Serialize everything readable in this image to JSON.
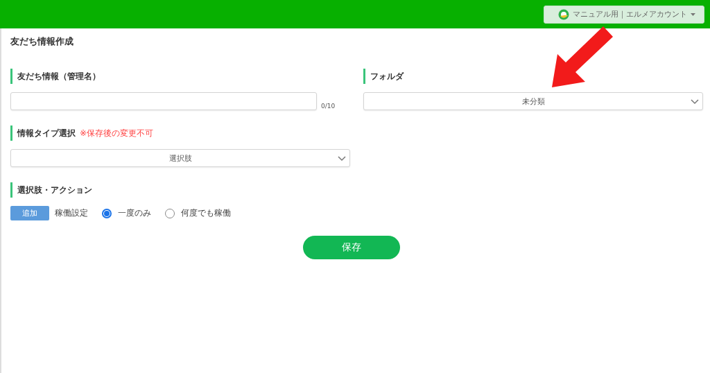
{
  "header": {
    "account": "マニュアル用｜エルメアカウント"
  },
  "page_title": "友だち情報作成",
  "name_field": {
    "label": "友だち情報（管理名）",
    "counter": "0/10"
  },
  "folder": {
    "label": "フォルダ",
    "value": "未分類"
  },
  "info_type": {
    "label": "情報タイプ選択",
    "note": "※保存後の変更不可",
    "value": "選択肢"
  },
  "actions": {
    "label": "選択肢・アクション",
    "add_button": "追加",
    "mode_label": "稼働設定",
    "options": [
      {
        "label": "一度のみ",
        "selected": true
      },
      {
        "label": "何度でも稼働",
        "selected": false
      }
    ]
  },
  "save_button": "保存"
}
